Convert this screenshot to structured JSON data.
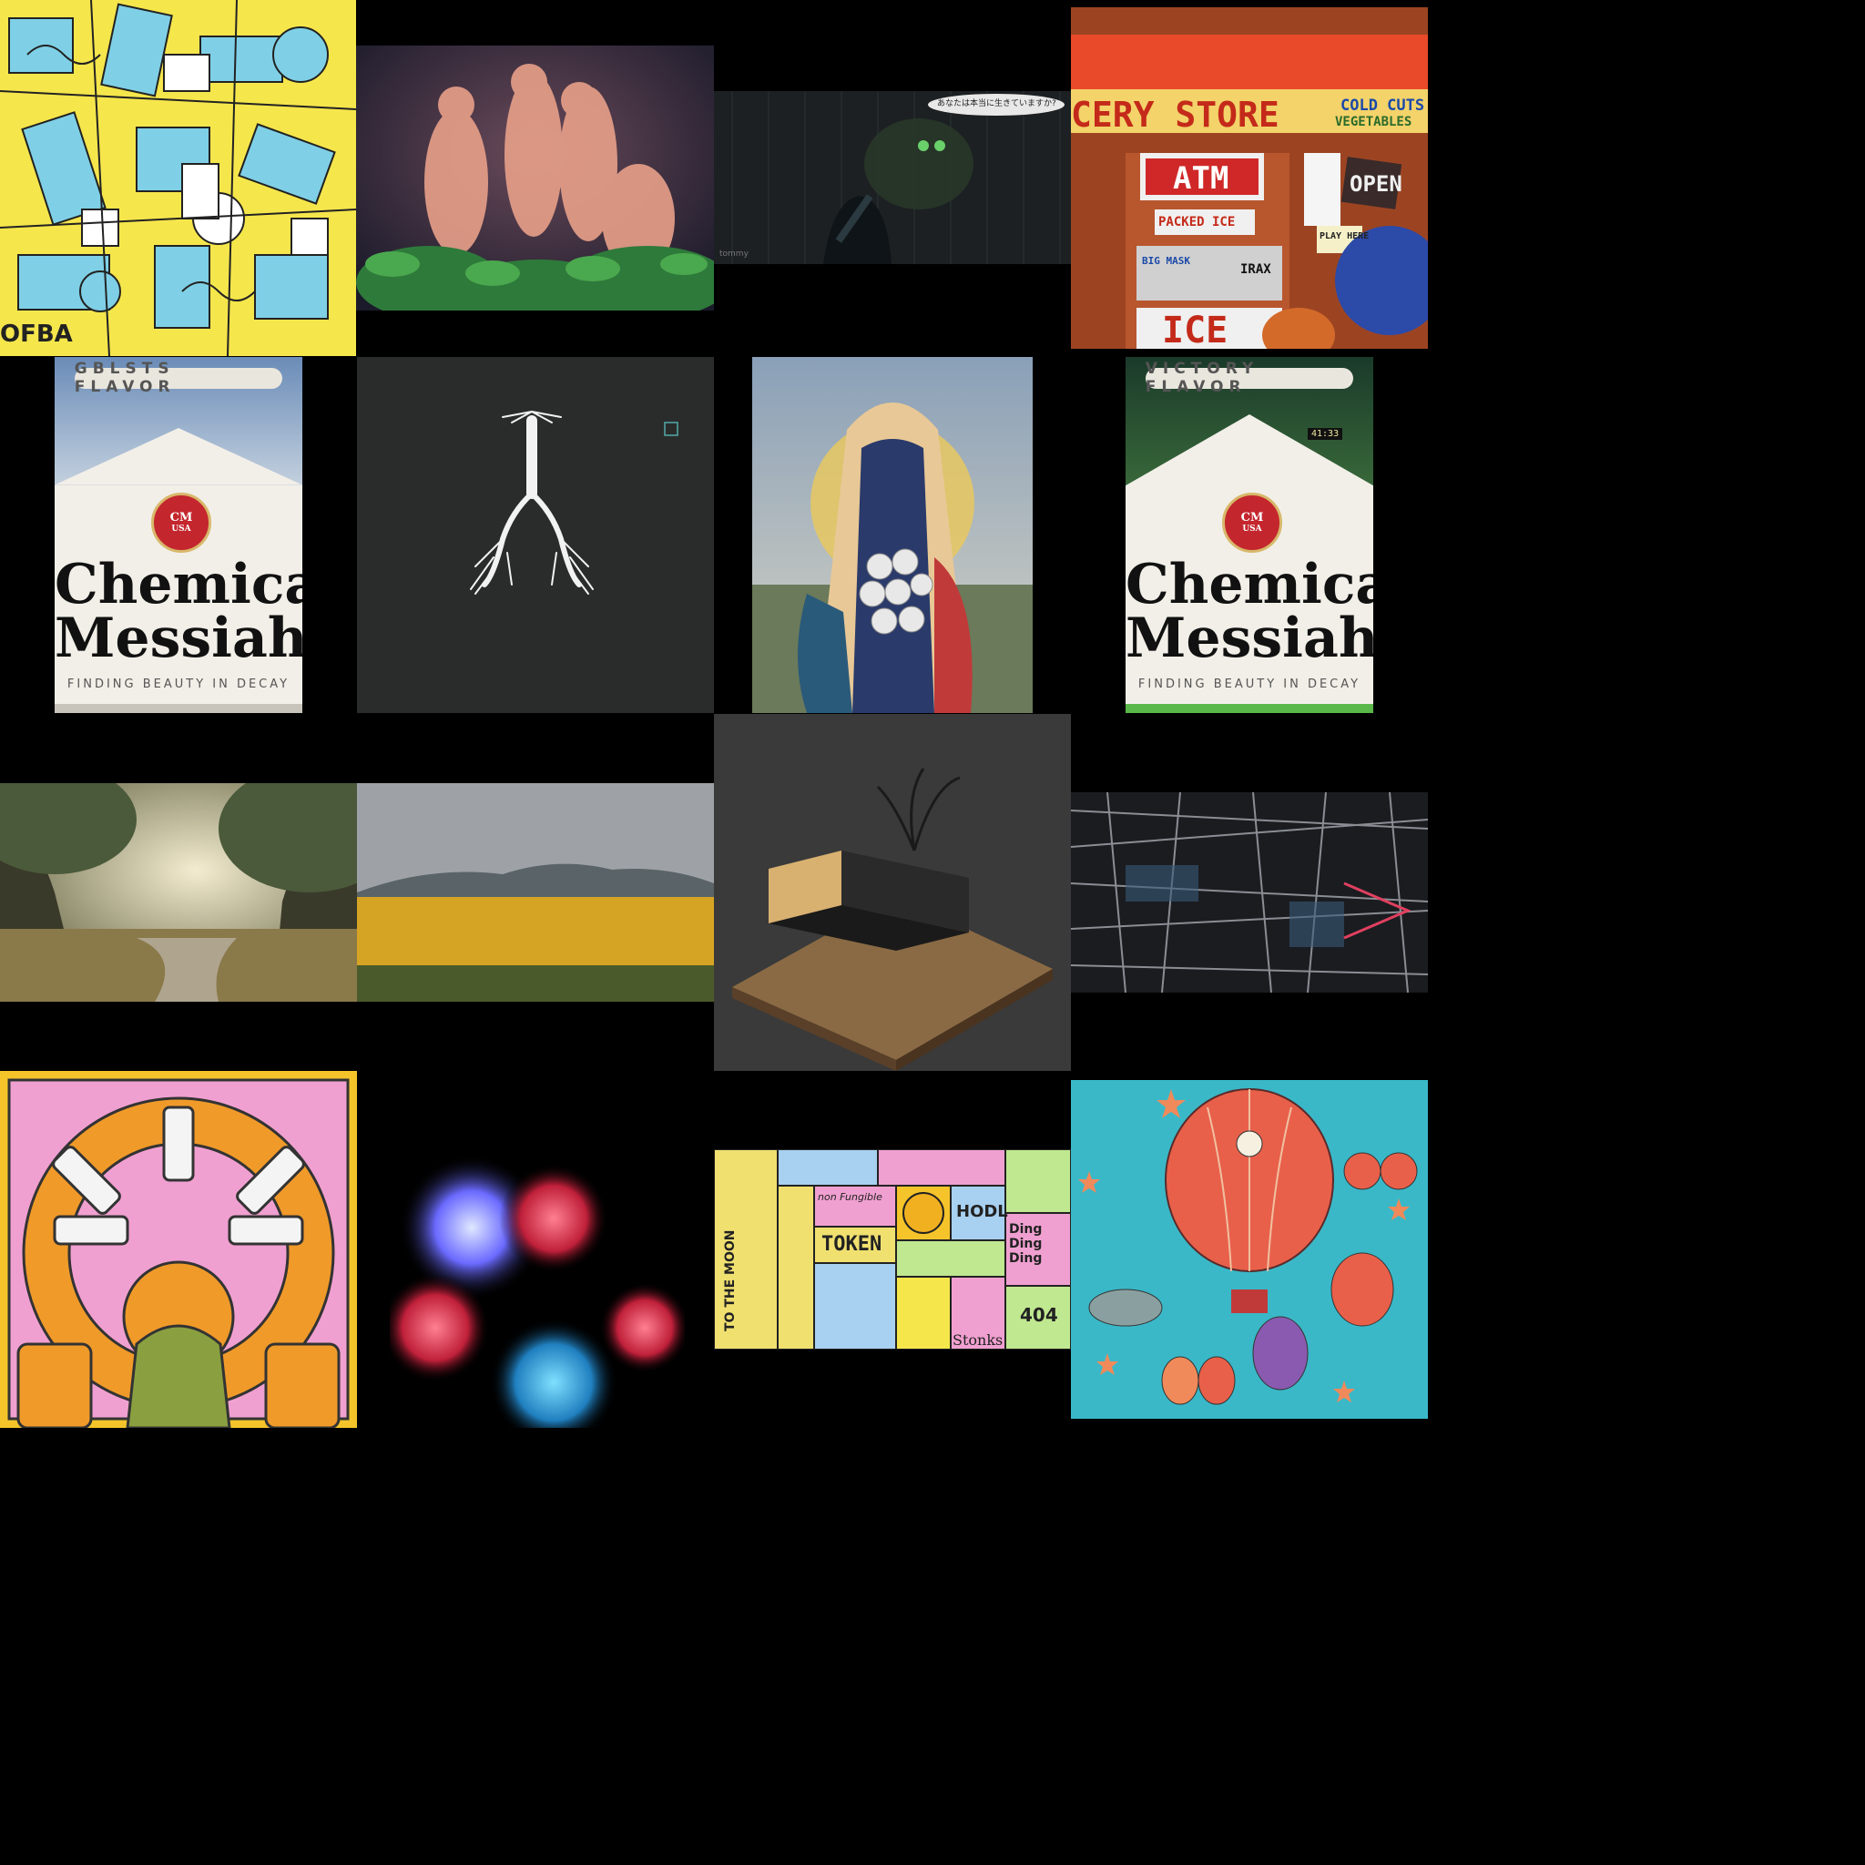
{
  "gallery": {
    "tile_grid_title": "",
    "tiles": [
      {
        "id": "doodle",
        "caption": "OFBA"
      },
      {
        "id": "glowing-figures"
      },
      {
        "id": "dark-tommy",
        "speech": "あなたは本当に生きていますか?",
        "signature": "tommy"
      },
      {
        "id": "grocery-store",
        "store_name": "CERY STORE",
        "cold_cuts": "COLD CUTS",
        "vegetables": "VEGETABLES",
        "atm": "ATM",
        "packed_ice": "PACKED ICE",
        "open": "OPEN",
        "ice": "ICE",
        "play_here": "PLAY HERE",
        "big_mask": "BIG MASK",
        "irax": "IRAX"
      },
      {
        "id": "chemical-messiah-1",
        "flavor": "GBLSTS FLAVOR",
        "crest_top": "CM",
        "crest_bottom": "USA",
        "title_line1": "Chemical",
        "title_line2": "Messiah",
        "tagline": "FINDING BEAUTY IN DECAY"
      },
      {
        "id": "lungs-tree"
      },
      {
        "id": "madonna-skulls"
      },
      {
        "id": "chemical-messiah-2",
        "flavor": "VICTORY FLAVOR",
        "crest_top": "CM",
        "crest_bottom": "USA",
        "title_line1": "Chemical",
        "title_line2": "Messiah",
        "tagline": "FINDING BEAUTY IN DECAY",
        "score": "41:33"
      },
      {
        "id": "forest-river"
      },
      {
        "id": "golden-field"
      },
      {
        "id": "house-tree"
      },
      {
        "id": "abstract-glitch"
      },
      {
        "id": "syringe-mandala"
      },
      {
        "id": "neon-blur"
      },
      {
        "id": "nft-collage",
        "side_text": "TO THE MOON",
        "token_word": "TOKEN",
        "non_fungible": "non Fungible",
        "ding": "Ding Ding Ding",
        "stonks": "Stonks",
        "hodl": "HODL",
        "num404": "404"
      },
      {
        "id": "hot-air-balloons"
      }
    ]
  },
  "colors": {
    "background": "#000000",
    "pack_red": "#c4262e",
    "pack_white": "#f2efe8"
  }
}
